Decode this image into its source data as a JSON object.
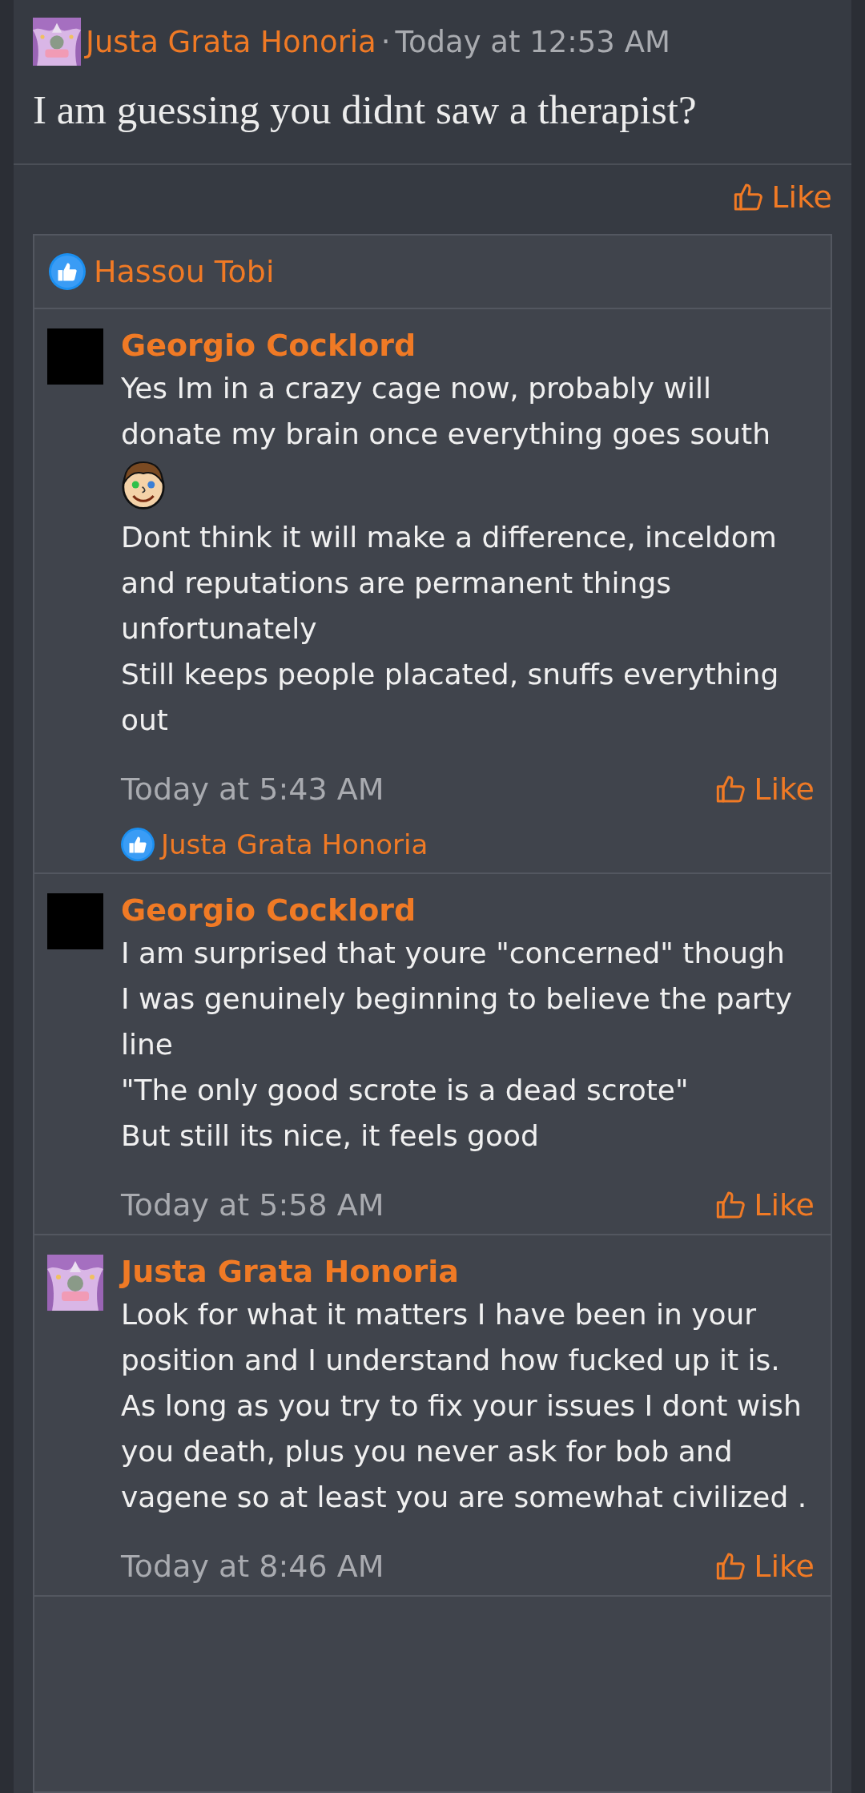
{
  "post": {
    "author": "Justa Grata Honoria",
    "separator": "·",
    "time": "Today at 12:53 AM",
    "text": "I am guessing you didnt saw a therapist?",
    "like_label": "Like"
  },
  "post_likes": {
    "likers": "Hassou Tobi"
  },
  "comments": [
    {
      "author": "Georgio Cocklord",
      "avatar": {
        "kind": "blank"
      },
      "body": [
        {
          "kind": "text",
          "text": "Yes Im in a crazy cage now, probably will donate my brain once everything goes south"
        },
        {
          "kind": "emoji"
        },
        {
          "kind": "text",
          "text": "Dont think it will make a difference, inceldom and reputations are permanent things unfortunately"
        },
        {
          "kind": "text",
          "text": "Still keeps people placated, snuffs everything out"
        }
      ],
      "time": "Today at 5:43 AM",
      "like_label": "Like",
      "likers": "Justa Grata Honoria"
    },
    {
      "author": "Georgio Cocklord",
      "avatar": {
        "kind": "blank"
      },
      "body": [
        {
          "kind": "text",
          "text": "I am surprised that youre \"concerned\" though"
        },
        {
          "kind": "text",
          "text": "I was genuinely beginning to believe the party line"
        },
        {
          "kind": "text",
          "text": "\"The only good scrote is a dead scrote\""
        },
        {
          "kind": "text",
          "text": "But still its nice, it feels good"
        }
      ],
      "time": "Today at 5:58 AM",
      "like_label": "Like"
    },
    {
      "author": "Justa Grata Honoria",
      "body": [
        {
          "kind": "text",
          "text": "Look for what it matters I have been in your position and I understand how fucked up it is. As long as you try to fix your issues I dont wish you death, plus you never ask for bob and vagene so at least you are somewhat civilized ."
        }
      ],
      "time": "Today at 8:46 AM",
      "like_label": "Like"
    }
  ]
}
